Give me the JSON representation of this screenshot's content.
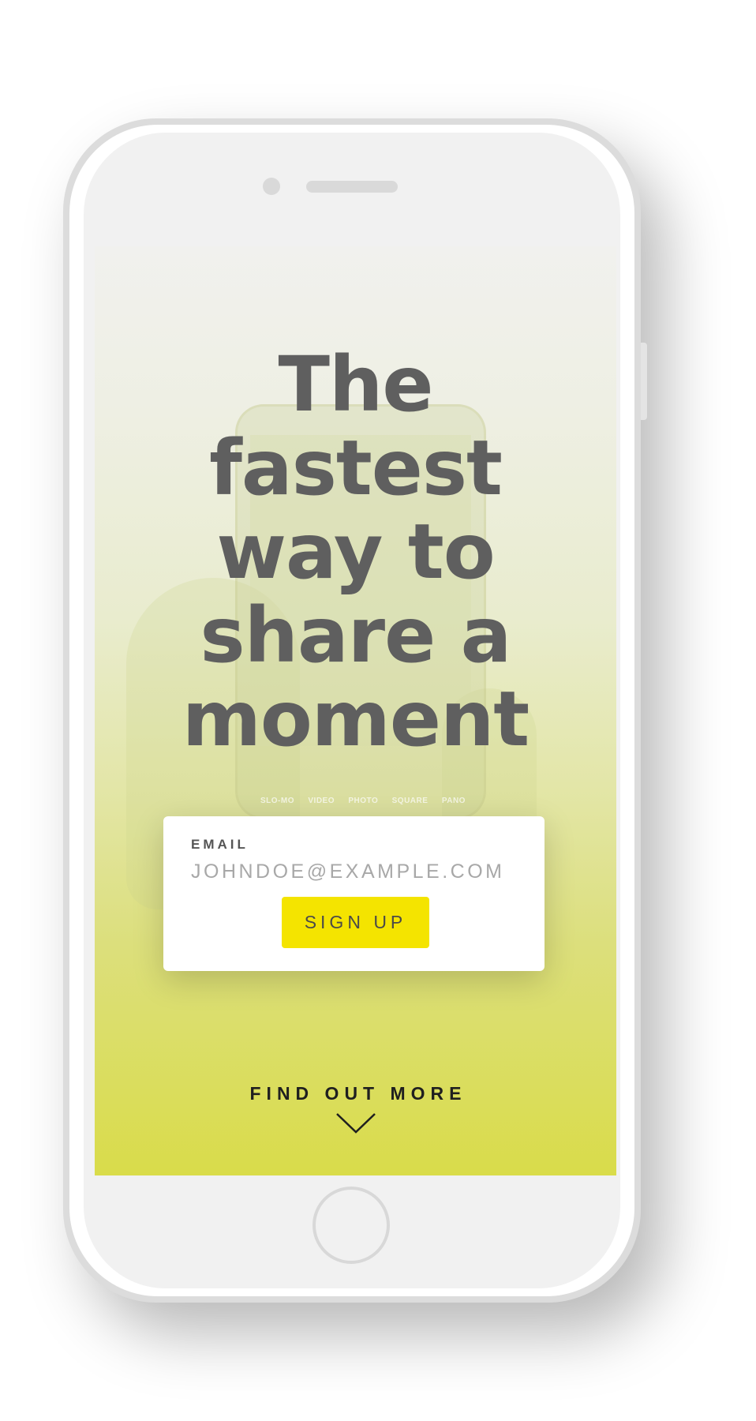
{
  "hero": {
    "headline_lines": [
      "The",
      "fastest",
      "way to",
      "share a",
      "moment"
    ]
  },
  "background": {
    "camera_modes": [
      "SLO-MO",
      "VIDEO",
      "PHOTO",
      "SQUARE",
      "PANO"
    ]
  },
  "signup": {
    "email_label": "EMAIL",
    "email_placeholder": "JOHNDOE@EXAMPLE.COM",
    "email_value": "",
    "button_label": "SIGN UP"
  },
  "footer": {
    "find_out_more_label": "FIND OUT MORE",
    "chevron_icon": "chevron-down-icon"
  },
  "colors": {
    "accent": "#f4e400",
    "headline": "#5f5f5f",
    "gradient_top": "#f1f1ee",
    "gradient_bottom": "#d9dc4a"
  }
}
